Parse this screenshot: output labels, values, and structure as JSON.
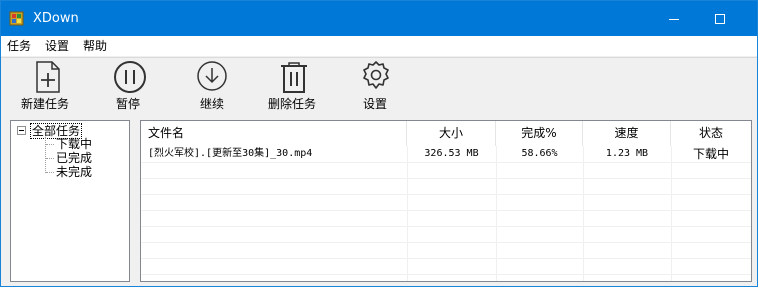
{
  "window": {
    "title": "XDown"
  },
  "menu": {
    "items": [
      "任务",
      "设置",
      "帮助"
    ]
  },
  "toolbar": {
    "new_task": "新建任务",
    "pause": "暂停",
    "resume": "继续",
    "delete_task": "删除任务",
    "settings": "设置"
  },
  "tree": {
    "root": "全部任务",
    "children": [
      "下载中",
      "已完成",
      "未完成"
    ]
  },
  "table": {
    "columns": [
      "文件名",
      "大小",
      "完成%",
      "速度",
      "状态"
    ],
    "rows": [
      {
        "filename": "[烈火军校].[更新至30集]_30.mp4",
        "size": "326.53 MB",
        "progress": "58.66%",
        "speed": "1.23 MB",
        "status": "下载中"
      }
    ]
  },
  "colors": {
    "titlebar": "#0078d7",
    "border": "#828790"
  },
  "icons": [
    "app-icon",
    "add-file-icon",
    "pause-icon",
    "download-icon",
    "trash-icon",
    "gear-icon"
  ]
}
